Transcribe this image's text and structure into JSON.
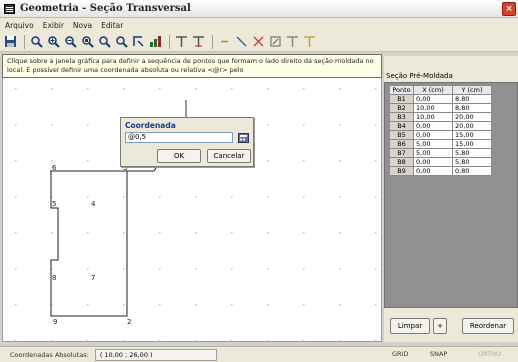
{
  "window": {
    "title": "Geometria - Seção Transversal",
    "close_glyph": "×"
  },
  "menu": {
    "items": [
      "Arquivo",
      "Exibir",
      "Nova",
      "Editar"
    ]
  },
  "toolbar": {
    "icons": [
      "save-icon",
      "zoom-icon",
      "zoom-in-icon",
      "zoom-out-icon",
      "zoom-window-icon",
      "zoom-previous-icon",
      "zoom-extents-icon",
      "pan-icon",
      "chart-icon",
      "text-icon",
      "text-style-icon",
      "point-icon",
      "line-icon",
      "delete-icon",
      "edit-icon",
      "filter-icon"
    ]
  },
  "hint": {
    "text": "Clique sobre a janela gráfica para definir a sequência de pontos que formam o lado direito da seção moldada no local. É possível definir uma coordenada absoluta ou relativa <@r> pelo"
  },
  "drawing": {
    "labels": [
      "6",
      "3",
      "5",
      "4",
      "8",
      "7",
      "9",
      "2"
    ]
  },
  "dialog": {
    "title": "Coordenada",
    "value": "@0,5",
    "ok_label": "OK",
    "cancel_label": "Cancelar"
  },
  "panel": {
    "title": "Seção Pré-Moldada",
    "columns": [
      "Ponto",
      "X (cm)",
      "Y (cm)"
    ],
    "rows": [
      [
        "B1",
        "0,00",
        "8,80"
      ],
      [
        "B2",
        "10,00",
        "8,80"
      ],
      [
        "B3",
        "10,00",
        "20,00"
      ],
      [
        "B4",
        "0,00",
        "20,00"
      ],
      [
        "B5",
        "0,00",
        "15,00"
      ],
      [
        "B6",
        "5,00",
        "15,00"
      ],
      [
        "B7",
        "5,00",
        "5,80"
      ],
      [
        "B8",
        "0,00",
        "5,80"
      ],
      [
        "B9",
        "0,00",
        "0,80"
      ]
    ],
    "limpar_label": "Limpar",
    "plus_label": "+",
    "reorder_label": "Reordenar"
  },
  "status": {
    "label": "Coordenadas Absolutas:",
    "coord": "( 10,00 ; 26,00 )",
    "grid": "GRID",
    "snap": "SNAP",
    "ortho": "ORTHO"
  }
}
